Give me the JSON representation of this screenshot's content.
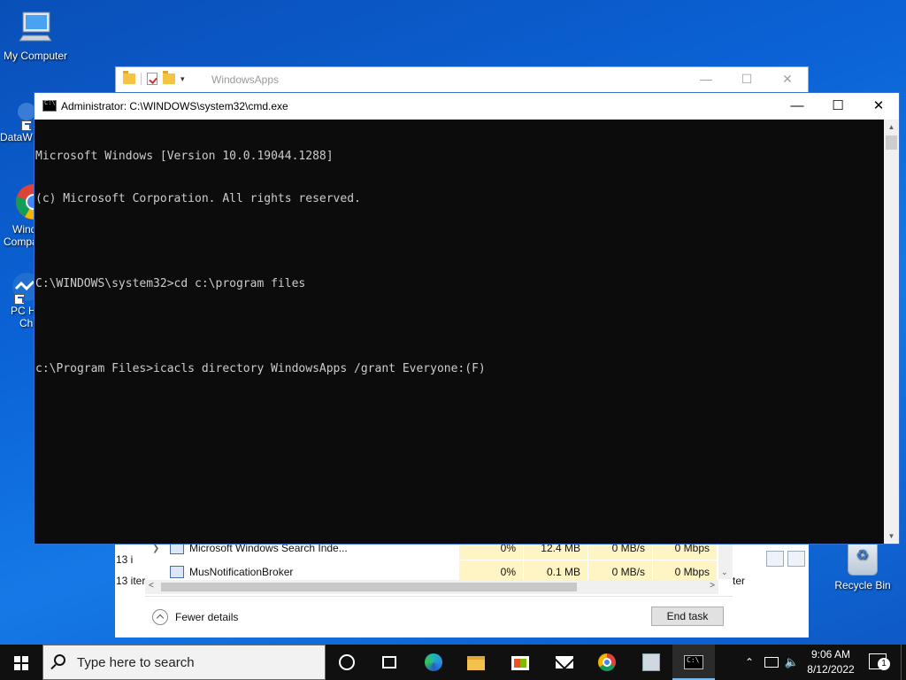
{
  "desktop": {
    "icons": [
      {
        "label": "My Computer"
      },
      {
        "label": "DataW"
      },
      {
        "label": "Wind"
      },
      {
        "label": "Compa"
      },
      {
        "label": "PC H"
      },
      {
        "label": "Ch"
      },
      {
        "label": "Recycle Bin"
      }
    ]
  },
  "explorer": {
    "title": "WindowsApps",
    "controls": {
      "minimize": "—",
      "maximize": "☐",
      "close": "✕"
    }
  },
  "task_manager": {
    "rows": [
      {
        "name": "Microsoft Windows Search Inde...",
        "cpu": "0%",
        "memory": "12.4 MB",
        "disk": "0 MB/s",
        "network": "0 Mbps"
      },
      {
        "name": "MusNotificationBroker",
        "cpu": "0%",
        "memory": "0.1 MB",
        "disk": "0 MB/s",
        "network": "0 Mbps"
      }
    ],
    "status_left_1": "13 i",
    "status_left_2": "13 iter",
    "status_right": "ter",
    "fewer_details": "Fewer details",
    "end_task": "End task"
  },
  "cmd": {
    "title": "Administrator: C:\\WINDOWS\\system32\\cmd.exe",
    "controls": {
      "minimize": "—",
      "maximize": "☐",
      "close": "✕"
    },
    "lines": [
      "Microsoft Windows [Version 10.0.19044.1288]",
      "(c) Microsoft Corporation. All rights reserved.",
      "",
      "C:\\WINDOWS\\system32>cd c:\\program files",
      "",
      "c:\\Program Files>icacls directory WindowsApps /grant Everyone:(F)"
    ]
  },
  "taskbar": {
    "search_placeholder": "Type here to search",
    "pinned": [
      "cortana",
      "task-view",
      "edge",
      "file-explorer",
      "store",
      "mail",
      "chrome",
      "pc-manager",
      "command-prompt"
    ],
    "time": "9:06 AM",
    "date": "8/12/2022",
    "notification_count": "1",
    "volume_glyph": "🔈",
    "chevron_glyph": "⌃"
  }
}
